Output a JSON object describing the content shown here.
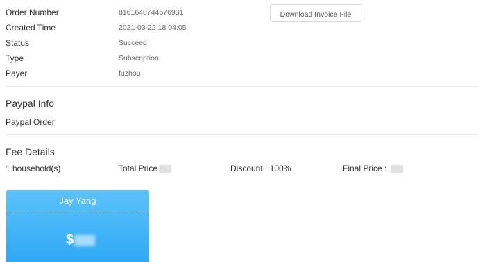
{
  "order": {
    "rows": [
      {
        "label": "Order Number",
        "value": "8161640744576931"
      },
      {
        "label": "Created Time",
        "value": "2021-03-22 18:04:05"
      },
      {
        "label": "Status",
        "value": "Succeed"
      },
      {
        "label": "Type",
        "value": "Subscription"
      },
      {
        "label": "Payer",
        "value": "fuzhou"
      }
    ],
    "download_label": "Download Invoice File"
  },
  "paypal": {
    "title": "Paypal Info",
    "order_label": "Paypal Order"
  },
  "fee": {
    "title": "Fee Details",
    "households": "1 household(s)",
    "total_price_label": "Total Price",
    "discount": "Discount : 100%",
    "final_price_label": "Final Price :"
  },
  "card": {
    "name": "Jay Yang",
    "currency": "$",
    "color_top": "#5cc2fb",
    "color_bottom": "#2fa9f5"
  }
}
